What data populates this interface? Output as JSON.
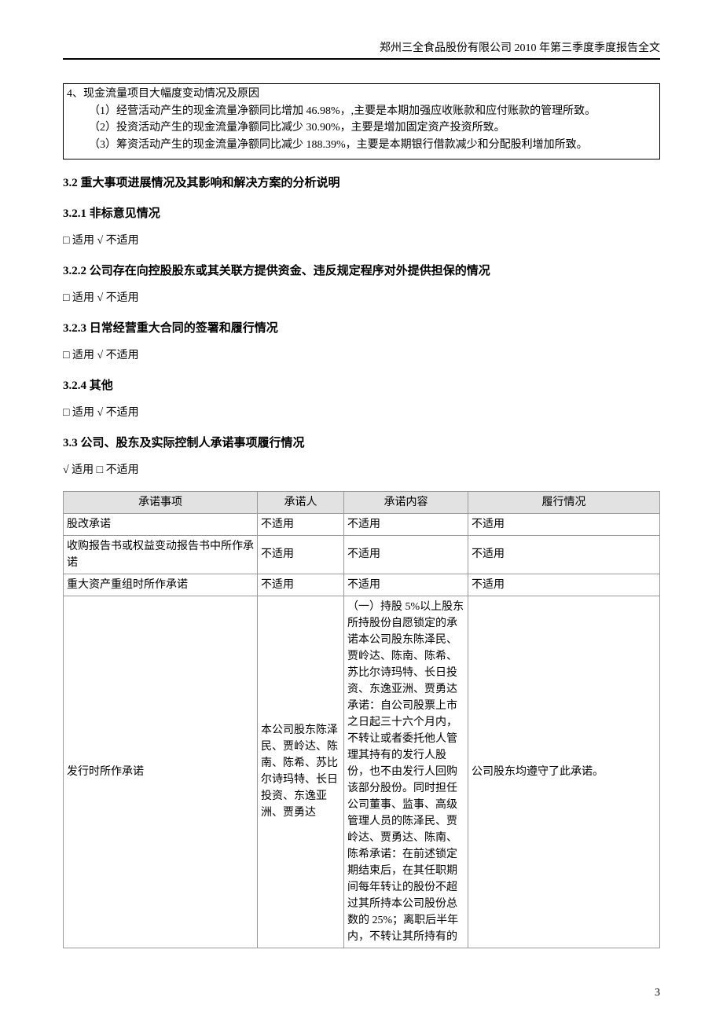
{
  "header": "郑州三全食品股份有限公司 2010 年第三季度季度报告全文",
  "box": {
    "title": "4、现金流量项目大幅度变动情况及原因",
    "lines": {
      "l1": "（1）经营活动产生的现金流量净额同比增加 46.98%，,主要是本期加强应收账款和应付账款的管理所致。",
      "l2": "（2）投资活动产生的现金流量净额同比减少 30.90%，主要是增加固定资产投资所致。",
      "l3": "（3）筹资活动产生的现金流量净额同比减少 188.39%，主要是本期银行借款减少和分配股利增加所致。"
    }
  },
  "sections": {
    "s32": "3.2 重大事项进展情况及其影响和解决方案的分析说明",
    "s321": "3.2.1 非标意见情况",
    "s322": "3.2.2 公司存在向控股股东或其关联方提供资金、违反规定程序对外提供担保的情况",
    "s323": "3.2.3 日常经营重大合同的签署和履行情况",
    "s324": "3.2.4 其他",
    "s33": "3.3 公司、股东及实际控制人承诺事项履行情况"
  },
  "apply": {
    "notApply": "□ 适用 √ 不适用",
    "apply": "√ 适用 □ 不适用"
  },
  "table": {
    "headers": {
      "c0": "承诺事项",
      "c1": "承诺人",
      "c2": "承诺内容",
      "c3": "履行情况"
    },
    "rows": [
      {
        "c0": "股改承诺",
        "c1": "不适用",
        "c2": "不适用",
        "c3": "不适用"
      },
      {
        "c0": "收购报告书或权益变动报告书中所作承诺",
        "c1": "不适用",
        "c2": "不适用",
        "c3": "不适用"
      },
      {
        "c0": "重大资产重组时所作承诺",
        "c1": "不适用",
        "c2": "不适用",
        "c3": "不适用"
      },
      {
        "c0": "发行时所作承诺",
        "c1": "本公司股东陈泽民、贾岭达、陈南、陈希、苏比尔诗玛特、长日投资、东逸亚洲、贾勇达",
        "c2": "（一）持股 5%以上股东所持股份自愿锁定的承诺本公司股东陈泽民、贾岭达、陈南、陈希、苏比尔诗玛特、长日投资、东逸亚洲、贾勇达承诺：自公司股票上市之日起三十六个月内，不转让或者委托他人管理其持有的发行人股份，也不由发行人回购该部分股份。同时担任公司董事、监事、高级管理人员的陈泽民、贾岭达、贾勇达、陈南、陈希承诺：在前述锁定期结束后，在其任职期间每年转让的股份不超过其所持本公司股份总数的 25%；离职后半年内，不转让其所持有的",
        "c3": "公司股东均遵守了此承诺。"
      }
    ]
  },
  "pageNumber": "3"
}
